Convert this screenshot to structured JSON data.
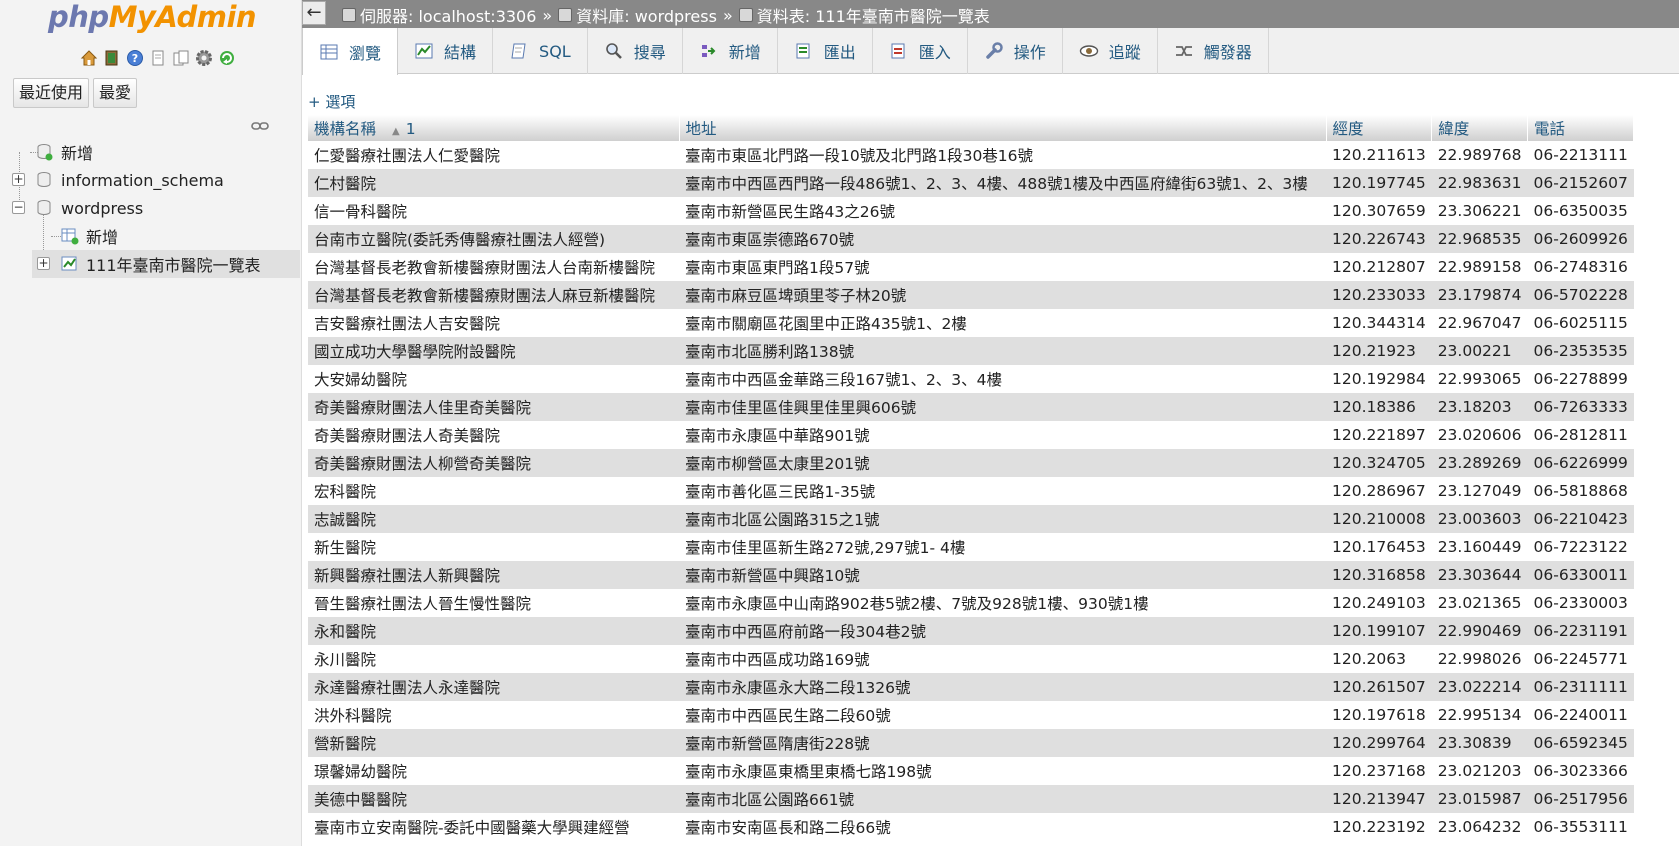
{
  "nav": {
    "logo_php": "php",
    "logo_myadmin": "MyAdmin",
    "recent_button": "最近使用",
    "favorites_button": "最愛",
    "tree": {
      "new_label": "新增",
      "dbs": [
        "information_schema",
        "wordpress"
      ],
      "wp_new_label": "新增",
      "table_label": "111年臺南市醫院一覽表"
    }
  },
  "breadcrumb": {
    "server": "伺服器: localhost:3306",
    "database": "資料庫: wordpress",
    "table": "資料表: 111年臺南市醫院一覽表",
    "sep": "»"
  },
  "tabs": [
    "瀏覽",
    "結構",
    "SQL",
    "搜尋",
    "新增",
    "匯出",
    "匯入",
    "操作",
    "追蹤",
    "觸發器"
  ],
  "options_link": "+ 選項",
  "table": {
    "headers": {
      "name": "機構名稱",
      "sort_index": "1",
      "address": "地址",
      "lng": "經度",
      "lat": "緯度",
      "phone": "電話"
    },
    "rows": [
      [
        "仁愛醫療社團法人仁愛醫院",
        "臺南市東區北門路一段10號及北門路1段30巷16號",
        "120.211613",
        "22.989768",
        "06-2213111"
      ],
      [
        "仁村醫院",
        "臺南市中西區西門路一段486號1、2、3、4樓、488號1樓及中西區府緯街63號1、2、3樓",
        "120.197745",
        "22.983631",
        "06-2152607"
      ],
      [
        "信一骨科醫院",
        "臺南市新營區民生路43之26號",
        "120.307659",
        "23.306221",
        "06-6350035"
      ],
      [
        "台南市立醫院(委託秀傳醫療社團法人經營)",
        "臺南市東區崇德路670號",
        "120.226743",
        "22.968535",
        "06-2609926"
      ],
      [
        "台灣基督長老教會新樓醫療財團法人台南新樓醫院",
        "臺南市東區東門路1段57號",
        "120.212807",
        "22.989158",
        "06-2748316"
      ],
      [
        "台灣基督長老教會新樓醫療財團法人麻豆新樓醫院",
        "臺南市麻豆區埤頭里苓子林20號",
        "120.233033",
        "23.179874",
        "06-5702228"
      ],
      [
        "吉安醫療社團法人吉安醫院",
        "臺南市關廟區花園里中正路435號1、2樓",
        "120.344314",
        "22.967047",
        "06-6025115"
      ],
      [
        "國立成功大學醫學院附設醫院",
        "臺南市北區勝利路138號",
        "120.21923",
        "23.00221",
        "06-2353535"
      ],
      [
        "大安婦幼醫院",
        "臺南市中西區金華路三段167號1、2、3、4樓",
        "120.192984",
        "22.993065",
        "06-2278899"
      ],
      [
        "奇美醫療財團法人佳里奇美醫院",
        "臺南市佳里區佳興里佳里興606號",
        "120.18386",
        "23.18203",
        "06-7263333"
      ],
      [
        "奇美醫療財團法人奇美醫院",
        "臺南市永康區中華路901號",
        "120.221897",
        "23.020606",
        "06-2812811"
      ],
      [
        "奇美醫療財團法人柳營奇美醫院",
        "臺南市柳營區太康里201號",
        "120.324705",
        "23.289269",
        "06-6226999"
      ],
      [
        "宏科醫院",
        "臺南市善化區三民路1-35號",
        "120.286967",
        "23.127049",
        "06-5818868"
      ],
      [
        "志誠醫院",
        "臺南市北區公園路315之1號",
        "120.210008",
        "23.003603",
        "06-2210423"
      ],
      [
        "新生醫院",
        "臺南市佳里區新生路272號,297號1- 4樓",
        "120.176453",
        "23.160449",
        "06-7223122"
      ],
      [
        "新興醫療社團法人新興醫院",
        "臺南市新營區中興路10號",
        "120.316858",
        "23.303644",
        "06-6330011"
      ],
      [
        "晉生醫療社團法人晉生慢性醫院",
        "臺南市永康區中山南路902巷5號2樓、7號及928號1樓、930號1樓",
        "120.249103",
        "23.021365",
        "06-2330003"
      ],
      [
        "永和醫院",
        "臺南市中西區府前路一段304巷2號",
        "120.199107",
        "22.990469",
        "06-2231191"
      ],
      [
        "永川醫院",
        "臺南市中西區成功路169號",
        "120.2063",
        "22.998026",
        "06-2245771"
      ],
      [
        "永達醫療社團法人永達醫院",
        "臺南市永康區永大路二段1326號",
        "120.261507",
        "23.022214",
        "06-2311111"
      ],
      [
        "洪外科醫院",
        "臺南市中西區民生路二段60號",
        "120.197618",
        "22.995134",
        "06-2240011"
      ],
      [
        "營新醫院",
        "臺南市新營區隋唐街228號",
        "120.299764",
        "23.30839",
        "06-6592345"
      ],
      [
        "璟馨婦幼醫院",
        "臺南市永康區東橋里東橋七路198號",
        "120.237168",
        "23.021203",
        "06-3023366"
      ],
      [
        "美德中醫醫院",
        "臺南市北區公園路661號",
        "120.213947",
        "23.015987",
        "06-2517956"
      ],
      [
        "臺南市立安南醫院-委託中國醫藥大學興建經營",
        "臺南市安南區長和路二段66號",
        "120.223192",
        "23.064232",
        "06-3553111"
      ]
    ]
  },
  "colors": {
    "link": "#235a81",
    "row_alt": "#dfdfdf",
    "topbar": "#888888",
    "logo_php": "#6c78af",
    "logo_myadmin": "#f29200"
  }
}
